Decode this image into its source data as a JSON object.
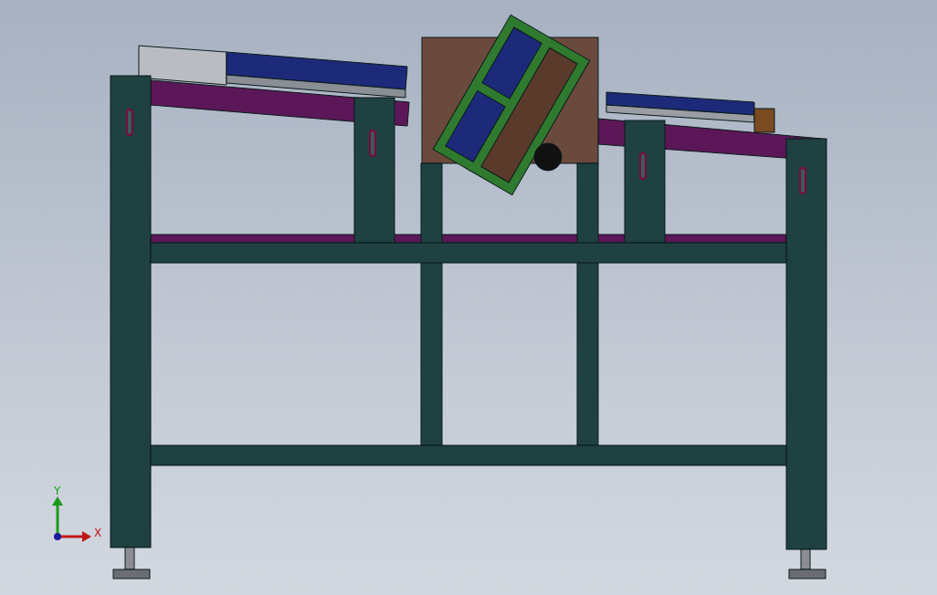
{
  "viewport": {
    "axis_triad": {
      "x_label": "X",
      "y_label": "Y"
    }
  }
}
